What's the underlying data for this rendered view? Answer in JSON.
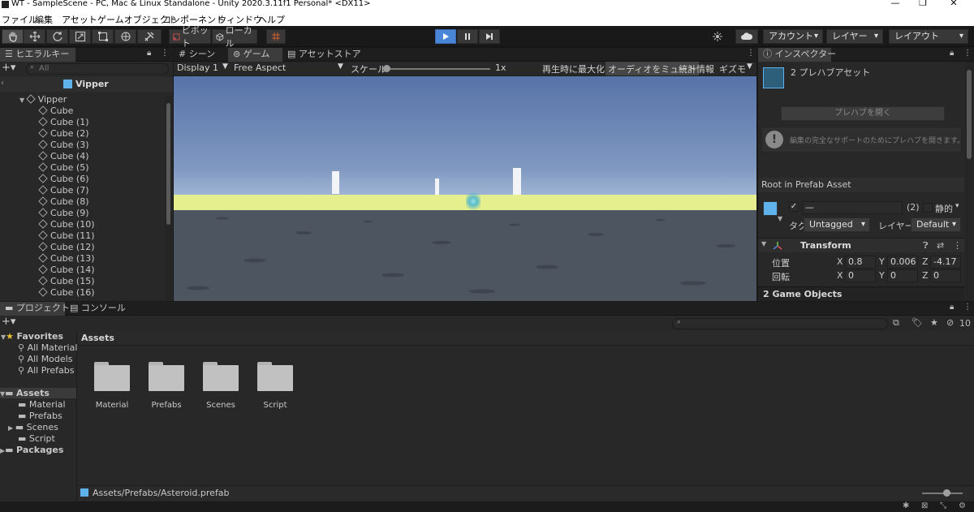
{
  "titlebar": {
    "title": "WT - SampleScene - PC, Mac & Linux Standalone - Unity 2020.3.11f1 Personal* <DX11>",
    "min": "—",
    "max": "❐",
    "close": "✕"
  },
  "menu": [
    "ファイル",
    "編集",
    "アセット",
    "ゲームオブジェクト",
    "コンポーネント",
    "ウィンドウ",
    "ヘルプ"
  ],
  "toolbar": {
    "pivot_label": "ピボット",
    "local_label": "ローカル",
    "account_label": "アカウント",
    "layers_label": "レイヤー",
    "layout_label": "レイアウト"
  },
  "hierarchy": {
    "tab_label": "ヒエラルキー",
    "search_placeholder": "All",
    "scene_title": "Vipper",
    "root": "Vipper",
    "items": [
      "Cube",
      "Cube (1)",
      "Cube (2)",
      "Cube (3)",
      "Cube (4)",
      "Cube (5)",
      "Cube (6)",
      "Cube (7)",
      "Cube (8)",
      "Cube (9)",
      "Cube (10)",
      "Cube (11)",
      "Cube (12)",
      "Cube (13)",
      "Cube (14)",
      "Cube (15)",
      "Cube (16)"
    ]
  },
  "center_tabs": [
    "シーン",
    "ゲーム",
    "アセットストア"
  ],
  "game_toolbar": {
    "display": "Display 1",
    "aspect": "Free Aspect",
    "scale_label": "スケール",
    "scale_value": "1x",
    "maximize": "再生時に最大化",
    "mute": "オーディオをミュート",
    "stats": "統計情報",
    "gizmos": "ギズモ"
  },
  "inspector": {
    "tab_label": "インスペクター",
    "prefab_count": "2 プレハブアセット",
    "open_prefab": "プレハブを開く",
    "info_text": "編集の完全なサポートのためにプレハブを開きます。",
    "root_label": "Root in Prefab Asset",
    "name_value": "—",
    "count": "(2)",
    "static_label": "静的",
    "tag_label": "タグ",
    "tag_value": "Untagged",
    "layer_label": "レイヤー",
    "layer_value": "Default",
    "transform_title": "Transform",
    "position_label": "位置",
    "rotation_label": "回転",
    "position": {
      "x": "0.8",
      "y": "0.006",
      "z": "-4.17"
    },
    "rotation": {
      "x": "0",
      "y": "0",
      "z": "0"
    },
    "axis_x": "X",
    "axis_y": "Y",
    "axis_z": "Z",
    "footer": "2 Game Objects"
  },
  "project": {
    "tab_project": "プロジェクト",
    "tab_console": "コンソール",
    "favorites_label": "Favorites",
    "favorites": [
      "All Material",
      "All Models",
      "All Prefabs"
    ],
    "assets_label": "Assets",
    "asset_children": [
      "Material",
      "Prefabs",
      "Scenes",
      "Script"
    ],
    "packages_label": "Packages",
    "breadcrumb": "Assets",
    "folders": [
      "Material",
      "Prefabs",
      "Scenes",
      "Script"
    ],
    "hidden_count": "10",
    "status_path": "Assets/Prefabs/Asteroid.prefab"
  },
  "colors": {
    "accent": "#4a86d8",
    "prefab_blue": "#5fb2ea",
    "ground_horizon": "#e6ef8e"
  }
}
